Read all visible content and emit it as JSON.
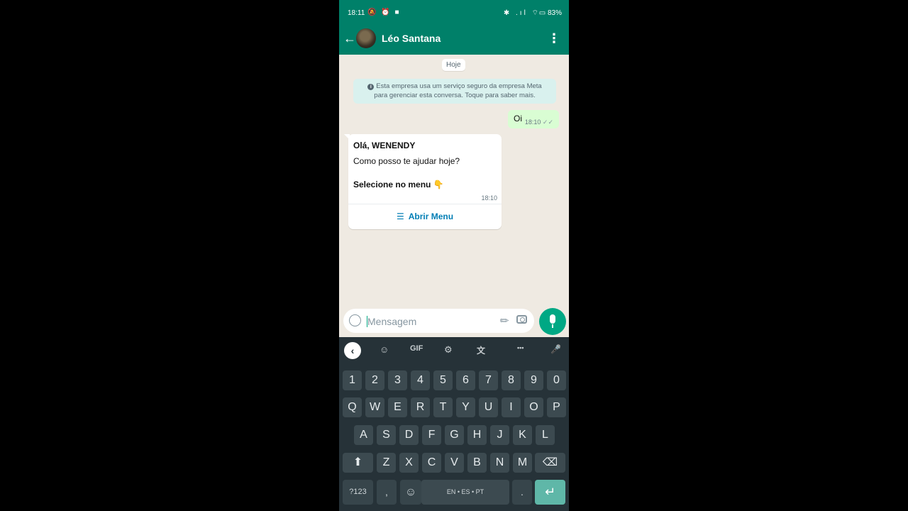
{
  "status_bar": {
    "time": "18:11",
    "left_icons": "🔕 ⏰ ■",
    "right_icons": "✱ .ıl ⌔",
    "battery": "▭ 83%"
  },
  "header": {
    "back_glyph": "←",
    "contact_name": "Léo Santana",
    "menu_glyph": "⋮"
  },
  "chat": {
    "date_chip": "Hoje",
    "notice_line1": "Esta empresa usa um serviço seguro da empresa Meta",
    "notice_line2": "para gerenciar esta conversa. Toque para saber mais.",
    "outgoing": {
      "text": "Oi",
      "time": "18:10",
      "ticks": "✓✓"
    },
    "incoming": {
      "greeting": "Olá, WENENDY",
      "question": "Como posso te ajudar hoje?",
      "select": "Selecione no menu",
      "select_emoji": "👇",
      "time": "18:10",
      "button_icon": "☰",
      "button_label": "Abrir Menu"
    }
  },
  "input": {
    "placeholder": "Mensagem"
  },
  "keyboard": {
    "toolbar": {
      "collapse": "‹",
      "sticker": "☺",
      "gif": "GIF",
      "settings": "⚙",
      "translate": "文",
      "more": "•••",
      "voice": "🎤"
    },
    "row_numbers": [
      "1",
      "2",
      "3",
      "4",
      "5",
      "6",
      "7",
      "8",
      "9",
      "0"
    ],
    "row_q": [
      "Q",
      "W",
      "E",
      "R",
      "T",
      "Y",
      "U",
      "I",
      "O",
      "P"
    ],
    "row_a": [
      "A",
      "S",
      "D",
      "F",
      "G",
      "H",
      "J",
      "K",
      "L"
    ],
    "row_z": [
      "Z",
      "X",
      "C",
      "V",
      "B",
      "N",
      "M"
    ],
    "shift": "⬆",
    "backspace": "⌫",
    "symbols": "?123",
    "comma": ",",
    "emoji": "☺",
    "space": "EN • ES • PT",
    "period": ".",
    "enter": "↵"
  }
}
